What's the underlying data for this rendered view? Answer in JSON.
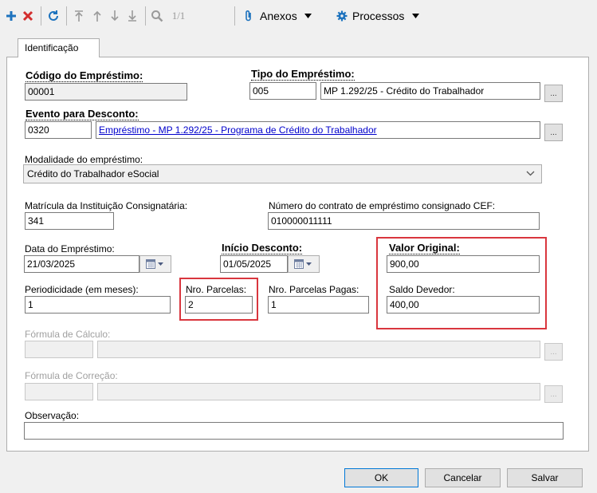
{
  "toolbar": {
    "page_indicator": "1/1",
    "attachments_label": "Anexos",
    "processes_label": "Processos"
  },
  "tabs": [
    {
      "label": "Identificação"
    }
  ],
  "form": {
    "codigo": {
      "label": "Código do Empréstimo:",
      "value": "00001"
    },
    "tipo": {
      "label": "Tipo do Empréstimo:",
      "code": "005",
      "desc": "MP 1.292/25 - Crédito do Trabalhador",
      "button": "..."
    },
    "evento": {
      "label": "Evento para Desconto:",
      "code": "0320",
      "desc": "Empréstimo - MP 1.292/25 - Programa de Crédito do Trabalhador",
      "button": "..."
    },
    "modalidade": {
      "label": "Modalidade do empréstimo:",
      "value": "Crédito do Trabalhador eSocial"
    },
    "matricula": {
      "label": "Matrícula da Instituição Consignatária:",
      "value": "341"
    },
    "contrato": {
      "label": "Número do contrato de empréstimo consignado CEF:",
      "value": "010000011111"
    },
    "data_emprestimo": {
      "label": "Data do Empréstimo:",
      "value": "21/03/2025"
    },
    "inicio_desconto": {
      "label": "Início Desconto:",
      "value": "01/05/2025"
    },
    "valor_original": {
      "label": "Valor Original:",
      "value": "900,00"
    },
    "periodicidade": {
      "label": "Periodicidade (em meses):",
      "value": "1"
    },
    "nro_parcelas": {
      "label": "Nro. Parcelas:",
      "value": "2"
    },
    "nro_parcelas_pagas": {
      "label": "Nro. Parcelas Pagas:",
      "value": "1"
    },
    "saldo_devedor": {
      "label": "Saldo Devedor:",
      "value": "400,00"
    },
    "formula_calculo": {
      "label": "Fórmula de Cálculo:",
      "button": "..."
    },
    "formula_correcao": {
      "label": "Fórmula de Correção:",
      "button": "..."
    },
    "observacao": {
      "label": "Observação:",
      "value": ""
    }
  },
  "buttons": {
    "ok": "OK",
    "cancel": "Cancelar",
    "save": "Salvar"
  },
  "colors": {
    "highlight": "#d9363e",
    "link": "#0000cc",
    "add": "#1e73be",
    "delete": "#d32f2f"
  }
}
